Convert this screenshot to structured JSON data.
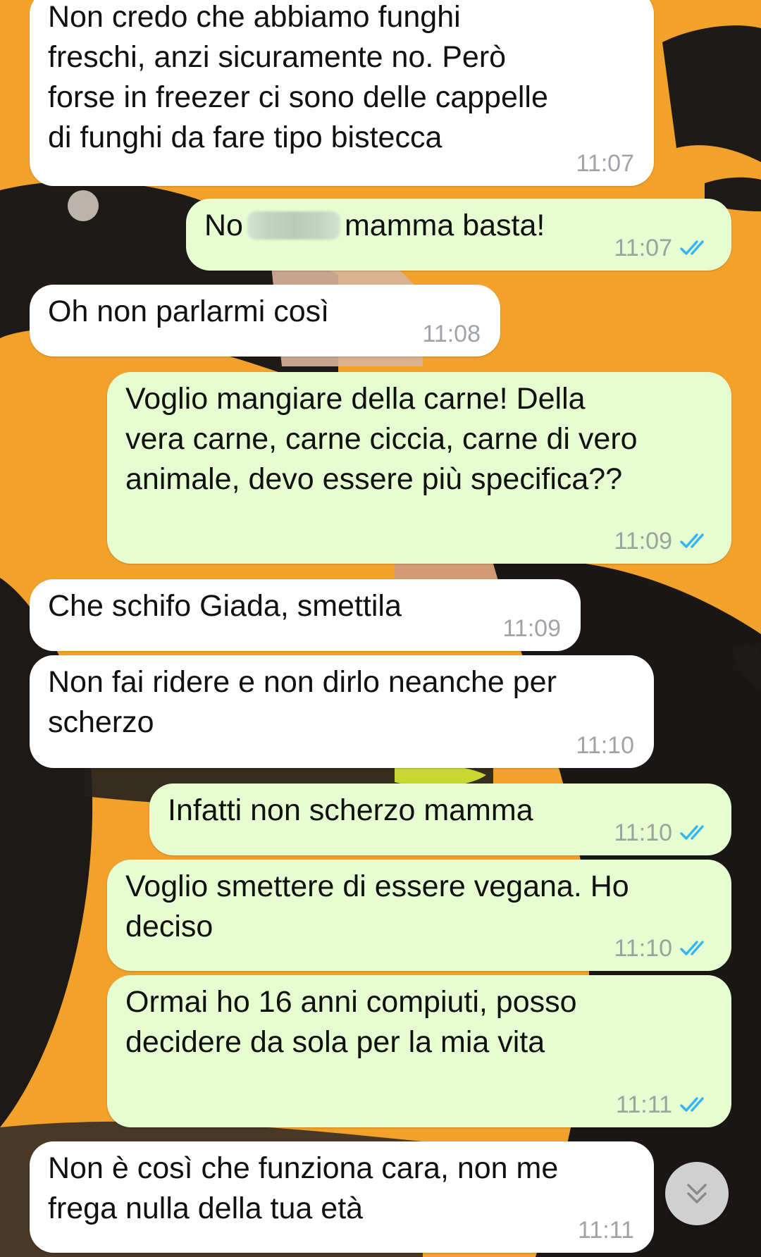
{
  "messages": [
    {
      "direction": "in",
      "text": "Non credo che abbiamo funghi\nfreschi, anzi sicuramente no. Però\nforse in freezer ci sono delle cappelle\ndi funghi da fare tipo bistecca",
      "time": "11:07"
    },
    {
      "direction": "out",
      "text_before": "No",
      "text_after": "mamma basta!",
      "time": "11:07",
      "read": true
    },
    {
      "direction": "in",
      "text": "Oh non parlarmi così",
      "time": "11:08"
    },
    {
      "direction": "out",
      "text": "Voglio mangiare della carne! Della\nvera carne, carne ciccia, carne di vero\nanimale, devo essere più specifica??",
      "time": "11:09",
      "read": true
    },
    {
      "direction": "in",
      "text": "Che schifo Giada, smettila",
      "time": "11:09"
    },
    {
      "direction": "in",
      "text": "Non fai ridere e non dirlo neanche per\nscherzo",
      "time": "11:10"
    },
    {
      "direction": "out",
      "text": "Infatti non scherzo mamma",
      "time": "11:10",
      "read": true
    },
    {
      "direction": "out",
      "text": "Voglio smettere di essere vegana. Ho\ndeciso",
      "time": "11:10",
      "read": true
    },
    {
      "direction": "out",
      "text": "Ormai ho 16 anni compiuti, posso\ndecidere da sola per la mia vita",
      "time": "11:11",
      "read": true
    },
    {
      "direction": "in",
      "text": "Non è così che funziona cara, non me\nfrega nulla della tua età",
      "time": "11:11"
    }
  ],
  "icons": {
    "read_receipt": "double-check-icon",
    "scroll_down": "chevron-double-down-icon",
    "censor": "blurred-name"
  },
  "colors": {
    "wallpaper": "#f2a12a",
    "incoming_bubble": "#ffffff",
    "outgoing_bubble": "#e6fdd2",
    "read_tick": "#34b7f1",
    "timestamp": "#9aa39c"
  }
}
